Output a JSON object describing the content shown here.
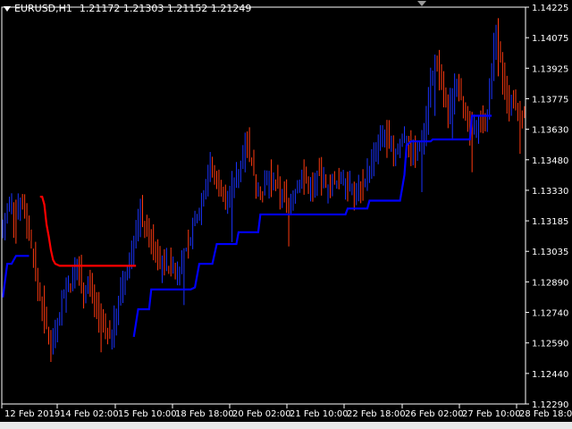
{
  "window": {
    "symbol_label": "EURUSD,H1",
    "ohlc": "1.21172 1.21303 1.21152 1.21249"
  },
  "colors": {
    "background": "#000000",
    "axis": "#ffffff",
    "bull_bar": "#1a33ff",
    "bear_bar": "#ff3a10",
    "signal_line_blue": "#0000ff",
    "signal_line_red": "#ff0000",
    "text": "#ffffff"
  },
  "icons": {
    "symbol_dropdown": "triangle-down",
    "chart_shift_marker": "triangle-down-grey"
  },
  "chart_data": {
    "type": "candlestick-bars-with-indicator",
    "title": "EURUSD,H1",
    "ylim": [
      1.1229,
      1.143
    ],
    "y_ticks": [
      "1.14225",
      "1.14075",
      "1.13925",
      "1.13775",
      "1.13630",
      "1.13480",
      "1.13330",
      "1.13185",
      "1.13035",
      "1.12890",
      "1.12740",
      "1.12590",
      "1.12440",
      "1.12290"
    ],
    "x_ticks": [
      "12 Feb 2019",
      "14 Feb 02:00",
      "15 Feb 10:00",
      "18 Feb 18:00",
      "20 Feb 02:00",
      "21 Feb 10:00",
      "22 Feb 18:00",
      "26 Feb 02:00",
      "27 Feb 10:00",
      "28 Feb 18:00"
    ],
    "price_path": [
      1.1318,
      1.1325,
      1.133,
      1.1328,
      1.1333,
      1.133,
      1.132,
      1.131,
      1.1295,
      1.1285,
      1.1275,
      1.1265,
      1.1258,
      1.1268,
      1.1275,
      1.1285,
      1.129,
      1.1288,
      1.13,
      1.1295,
      1.1285,
      1.129,
      1.1285,
      1.128,
      1.1272,
      1.1268,
      1.1262,
      1.1265,
      1.1275,
      1.1285,
      1.129,
      1.1298,
      1.131,
      1.1318,
      1.1325,
      1.132,
      1.1315,
      1.1308,
      1.1305,
      1.13,
      1.1302,
      1.1298,
      1.13,
      1.1295,
      1.13,
      1.1305,
      1.131,
      1.1318,
      1.1325,
      1.133,
      1.134,
      1.135,
      1.1345,
      1.1342,
      1.1338,
      1.133,
      1.1335,
      1.134,
      1.1345,
      1.135,
      1.1368,
      1.1355,
      1.1345,
      1.134,
      1.1335,
      1.134,
      1.1343,
      1.134,
      1.1338,
      1.1335,
      1.1333,
      1.133,
      1.1335,
      1.134,
      1.1345,
      1.1342,
      1.1338,
      1.134,
      1.1345,
      1.1343,
      1.134,
      1.1338,
      1.134,
      1.1342,
      1.1345,
      1.134,
      1.1338,
      1.1335,
      1.1338,
      1.134,
      1.1345,
      1.135,
      1.1355,
      1.136,
      1.1365,
      1.1362,
      1.1358,
      1.1355,
      1.136,
      1.1365,
      1.1362,
      1.1358,
      1.1355,
      1.136,
      1.1365,
      1.138,
      1.1395,
      1.14,
      1.1395,
      1.1385,
      1.1375,
      1.1385,
      1.1395,
      1.139,
      1.1375,
      1.137,
      1.1365,
      1.137,
      1.1375,
      1.1372,
      1.1378,
      1.14,
      1.142,
      1.1405,
      1.1385,
      1.1378,
      1.1382,
      1.1378,
      1.1372,
      1.1375
    ],
    "indicator_blue": {
      "style": "step-line",
      "segments": [
        {
          "from": 0,
          "to": 13,
          "points": [
            [
              0,
              1.1283
            ],
            [
              2,
              1.13
            ],
            [
              4,
              1.13
            ],
            [
              6,
              1.1304
            ],
            [
              9,
              1.1304
            ],
            [
              12,
              1.1304
            ]
          ]
        },
        {
          "from": 60,
          "to": 150,
          "points": [
            [
              60,
              1.1263
            ],
            [
              62,
              1.1277
            ],
            [
              67,
              1.1277
            ],
            [
              68,
              1.1287
            ],
            [
              86,
              1.1287
            ],
            [
              88,
              1.1288
            ],
            [
              90,
              1.13
            ],
            [
              96,
              1.13
            ],
            [
              98,
              1.131
            ],
            [
              107,
              1.131
            ],
            [
              108,
              1.1316
            ],
            [
              117,
              1.1316
            ],
            [
              118,
              1.1325
            ],
            [
              157,
              1.1325
            ],
            [
              158,
              1.1328
            ],
            [
              167,
              1.1328
            ],
            [
              168,
              1.1332
            ],
            [
              182,
              1.1332
            ],
            [
              184,
              1.1345
            ],
            [
              185,
              1.136
            ],
            [
              187,
              1.1362
            ],
            [
              196,
              1.1362
            ],
            [
              197,
              1.1363
            ],
            [
              214,
              1.1363
            ],
            [
              215,
              1.1375
            ],
            [
              224,
              1.1375
            ]
          ]
        }
      ]
    },
    "indicator_red": {
      "style": "line",
      "points": [
        [
          17,
          1.1334
        ],
        [
          18,
          1.1334
        ],
        [
          19,
          1.133
        ],
        [
          20,
          1.132
        ],
        [
          21,
          1.1314
        ],
        [
          22,
          1.1307
        ],
        [
          23,
          1.1302
        ],
        [
          24,
          1.13
        ],
        [
          26,
          1.1299
        ],
        [
          40,
          1.1299
        ],
        [
          61,
          1.1299
        ]
      ]
    }
  }
}
